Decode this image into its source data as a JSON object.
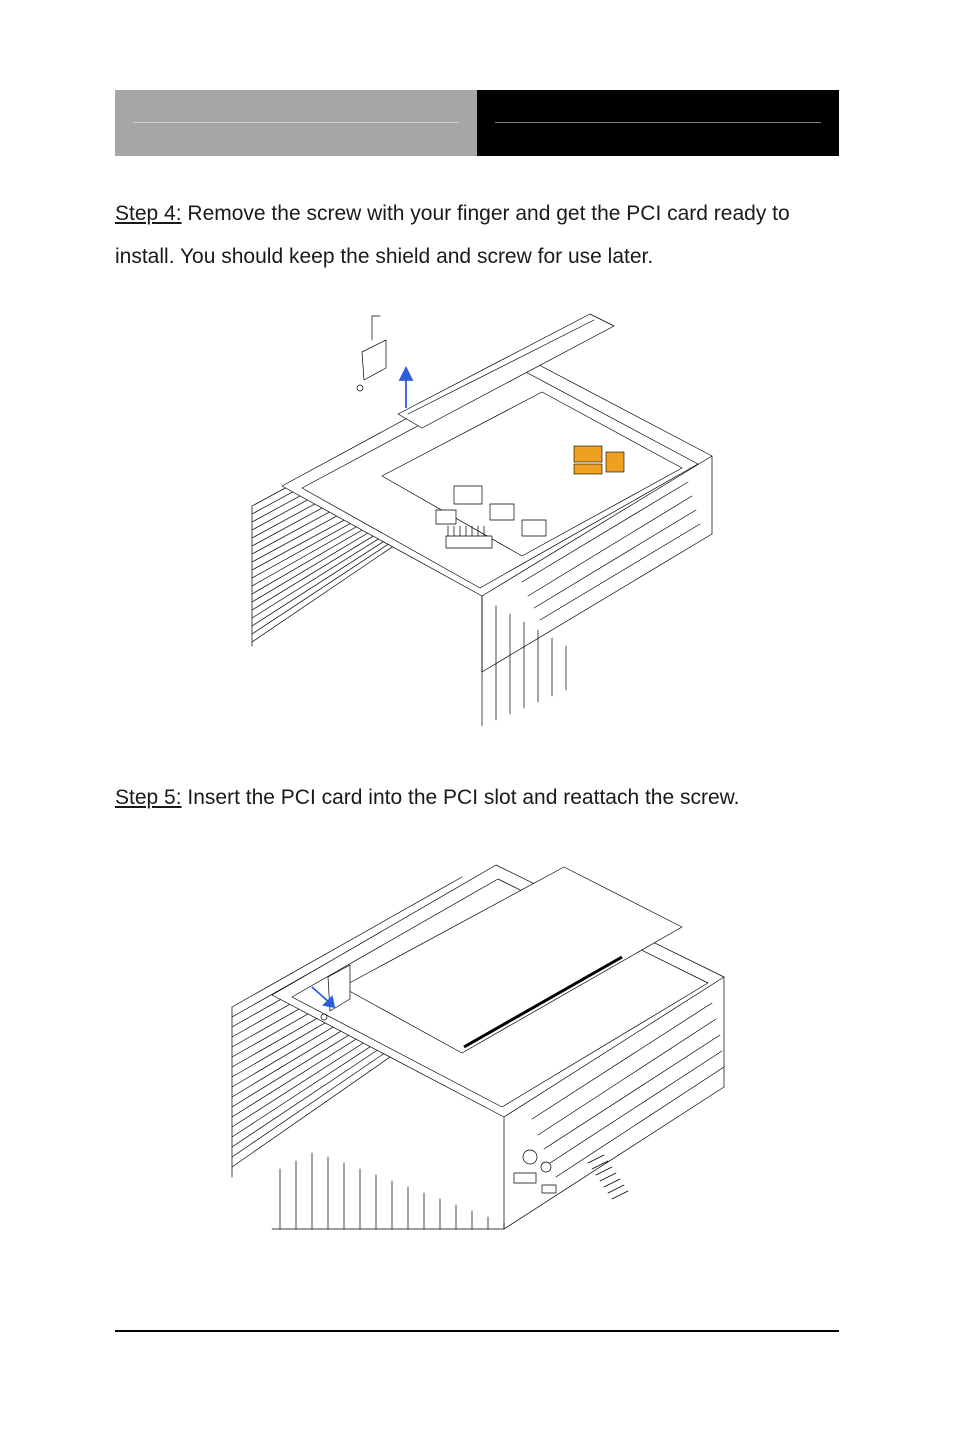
{
  "steps": {
    "step4": {
      "label": "Step 4:",
      "text_a": "  Remove the screw with your finger and get the PCI card ready to",
      "text_b": "install.    You should keep the shield and screw for use later."
    },
    "step5": {
      "label": "Step 5:",
      "text": "  Insert the PCI card into the PCI slot and reattach the screw."
    }
  },
  "figures": {
    "fig1_alt": "Isometric line drawing of an open fanless embedded PC chassis with the top cover removed. A PCI slot bracket and screw are shown lifted above the expansion slot; an arrow indicates removing the bracket. Internal board with connectors, a riser slot, and the finned heatsink side are visible.",
    "fig2_alt": "Isometric line drawing of the same chassis at a lower angle with a full-length PCI expansion card seated in the riser slot. The bracket screw location is indicated. Front panel shows power button, LEDs and I/O; side shows cooling fins."
  },
  "colors": {
    "header_grey": "#a6a6a6",
    "header_black": "#000000",
    "board_accent": "#f0a020",
    "arrow_blue": "#2b5fd9"
  }
}
